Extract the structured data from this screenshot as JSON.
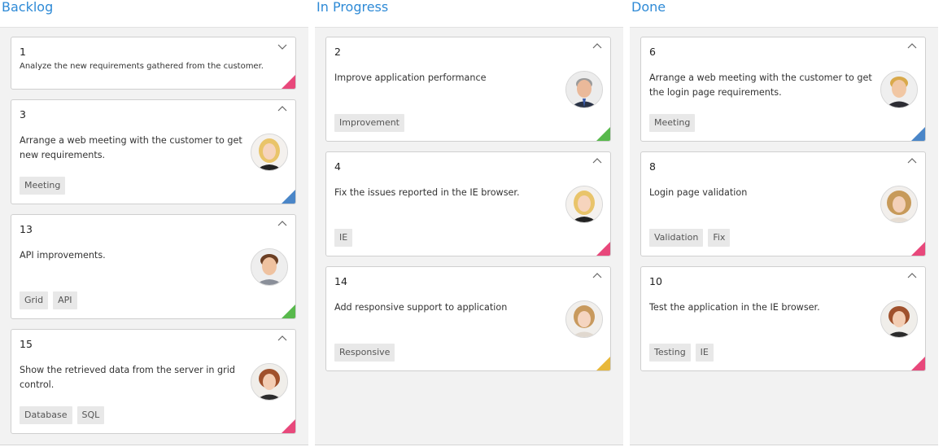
{
  "colors": {
    "accent": "#2e8ad6",
    "pink": "#e8487b",
    "blue": "#4a86c8",
    "green": "#58b94c",
    "yellow": "#e8b83a"
  },
  "columns": [
    {
      "title": "Backlog",
      "cards": [
        {
          "id": "1",
          "text": "Analyze the new requirements gathered from the customer.",
          "tags": [],
          "avatar": "",
          "priority_color": "#e8487b",
          "expanded": false
        },
        {
          "id": "3",
          "text": "Arrange a web meeting with the customer to get new requirements.",
          "tags": [
            "Meeting"
          ],
          "avatar": "woman-blonde",
          "priority_color": "#4a86c8",
          "expanded": true
        },
        {
          "id": "13",
          "text": "API improvements.",
          "tags": [
            "Grid",
            "API"
          ],
          "avatar": "man-brown",
          "priority_color": "#58b94c",
          "expanded": true
        },
        {
          "id": "15",
          "text": "Show the retrieved data from the server in grid control.",
          "tags": [
            "Database",
            "SQL"
          ],
          "avatar": "woman-auburn",
          "priority_color": "#e8487b",
          "expanded": true
        }
      ]
    },
    {
      "title": "In Progress",
      "cards": [
        {
          "id": "2",
          "text": "Improve application performance",
          "tags": [
            "Improvement"
          ],
          "avatar": "man-grey",
          "priority_color": "#58b94c",
          "expanded": true
        },
        {
          "id": "4",
          "text": "Fix the issues reported in the IE browser.",
          "tags": [
            "IE"
          ],
          "avatar": "woman-blonde",
          "priority_color": "#e8487b",
          "expanded": true
        },
        {
          "id": "14",
          "text": "Add responsive support to application",
          "tags": [
            "Responsive"
          ],
          "avatar": "woman-light",
          "priority_color": "#e8b83a",
          "expanded": true
        }
      ]
    },
    {
      "title": "Done",
      "cards": [
        {
          "id": "6",
          "text": "Arrange a web meeting with the customer to get the login page requirements.",
          "tags": [
            "Meeting"
          ],
          "avatar": "man-blond",
          "priority_color": "#4a86c8",
          "expanded": true
        },
        {
          "id": "8",
          "text": "Login page validation",
          "tags": [
            "Validation",
            "Fix"
          ],
          "avatar": "woman-wavy",
          "priority_color": "#e8487b",
          "expanded": true
        },
        {
          "id": "10",
          "text": "Test the application in the IE browser.",
          "tags": [
            "Testing",
            "IE"
          ],
          "avatar": "woman-auburn",
          "priority_color": "#e8487b",
          "expanded": true
        }
      ]
    }
  ]
}
